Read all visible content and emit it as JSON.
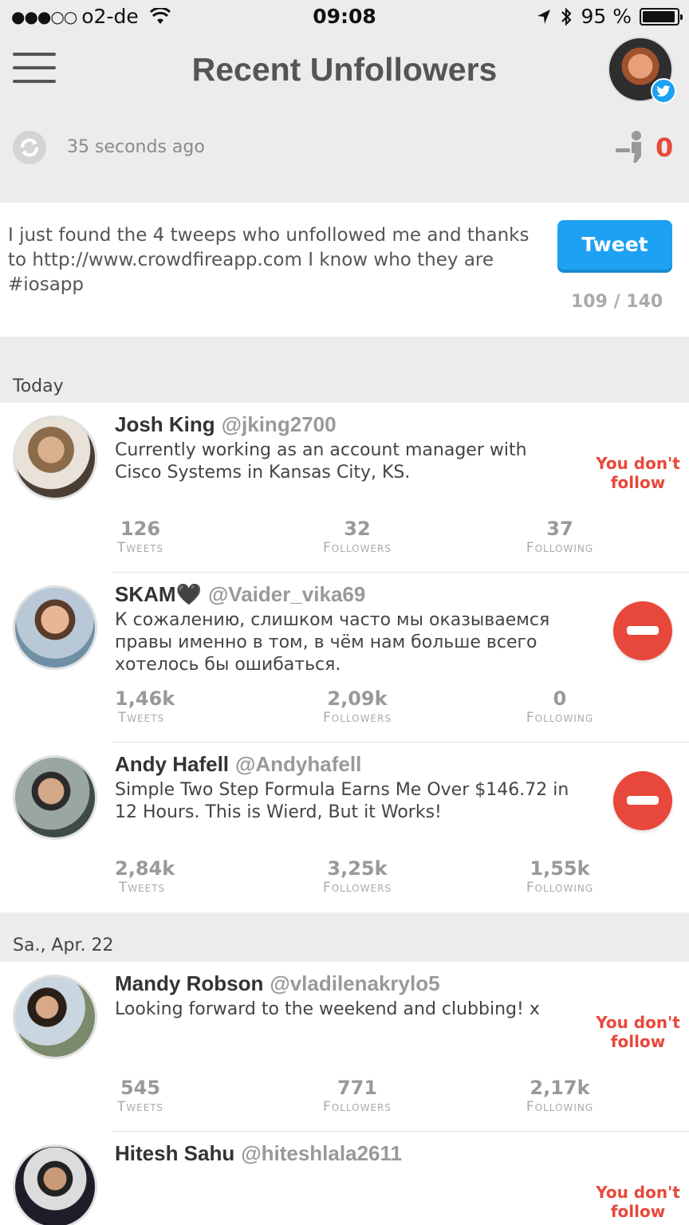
{
  "status_bar": {
    "carrier": "o2-de",
    "signal_dots": "●●●○○",
    "time": "09:08",
    "battery_percent": "95 %",
    "battery_level": 0.95
  },
  "header": {
    "title": "Recent Unfollowers"
  },
  "sync": {
    "last_updated": "35 seconds ago",
    "unfollow_count": "0"
  },
  "compose": {
    "text": "I just found the 4 tweeps who unfollowed me and thanks to http://www.crowdfireapp.com I know who they are #iosapp",
    "button_label": "Tweet",
    "char_count": "109 / 140"
  },
  "sections": [
    {
      "label": "Today"
    },
    {
      "label": "Sa., Apr. 22"
    }
  ],
  "users": [
    {
      "name": "Josh King",
      "handle": "@jking2700",
      "bio": "Currently working as an account manager with Cisco Systems in Kansas City, KS.",
      "status": "You don't follow",
      "tweets": "126",
      "followers": "32",
      "following": "37"
    },
    {
      "name": "SKAM🖤",
      "handle": "@Vaider_vika69",
      "bio": "К сожалению, слишком часто мы оказываемся правы именно в том, в чём нам больше всего хотелось бы ошибаться.",
      "status": "",
      "tweets": "1,46k",
      "followers": "2,09k",
      "following": "0"
    },
    {
      "name": "Andy Hafell",
      "handle": "@Andyhafell",
      "bio": "Simple Two Step Formula Earns Me Over $146.72 in 12 Hours. This is Wierd, But it Works!",
      "status": "",
      "tweets": "2,84k",
      "followers": "3,25k",
      "following": "1,55k"
    },
    {
      "name": "Mandy Robson",
      "handle": "@vladilenakrylo5",
      "bio": "Looking forward to the weekend and clubbing! x",
      "status": "You don't follow",
      "tweets": "545",
      "followers": "771",
      "following": "2,17k"
    },
    {
      "name": "Hitesh Sahu",
      "handle": "@hiteshlala2611",
      "bio": "",
      "status": "You don't follow"
    }
  ],
  "stat_labels": {
    "tweets": "Tweets",
    "followers": "Followers",
    "following": "Following"
  },
  "colors": {
    "accent_red": "#e8483b",
    "twitter_blue": "#1da1f2"
  }
}
